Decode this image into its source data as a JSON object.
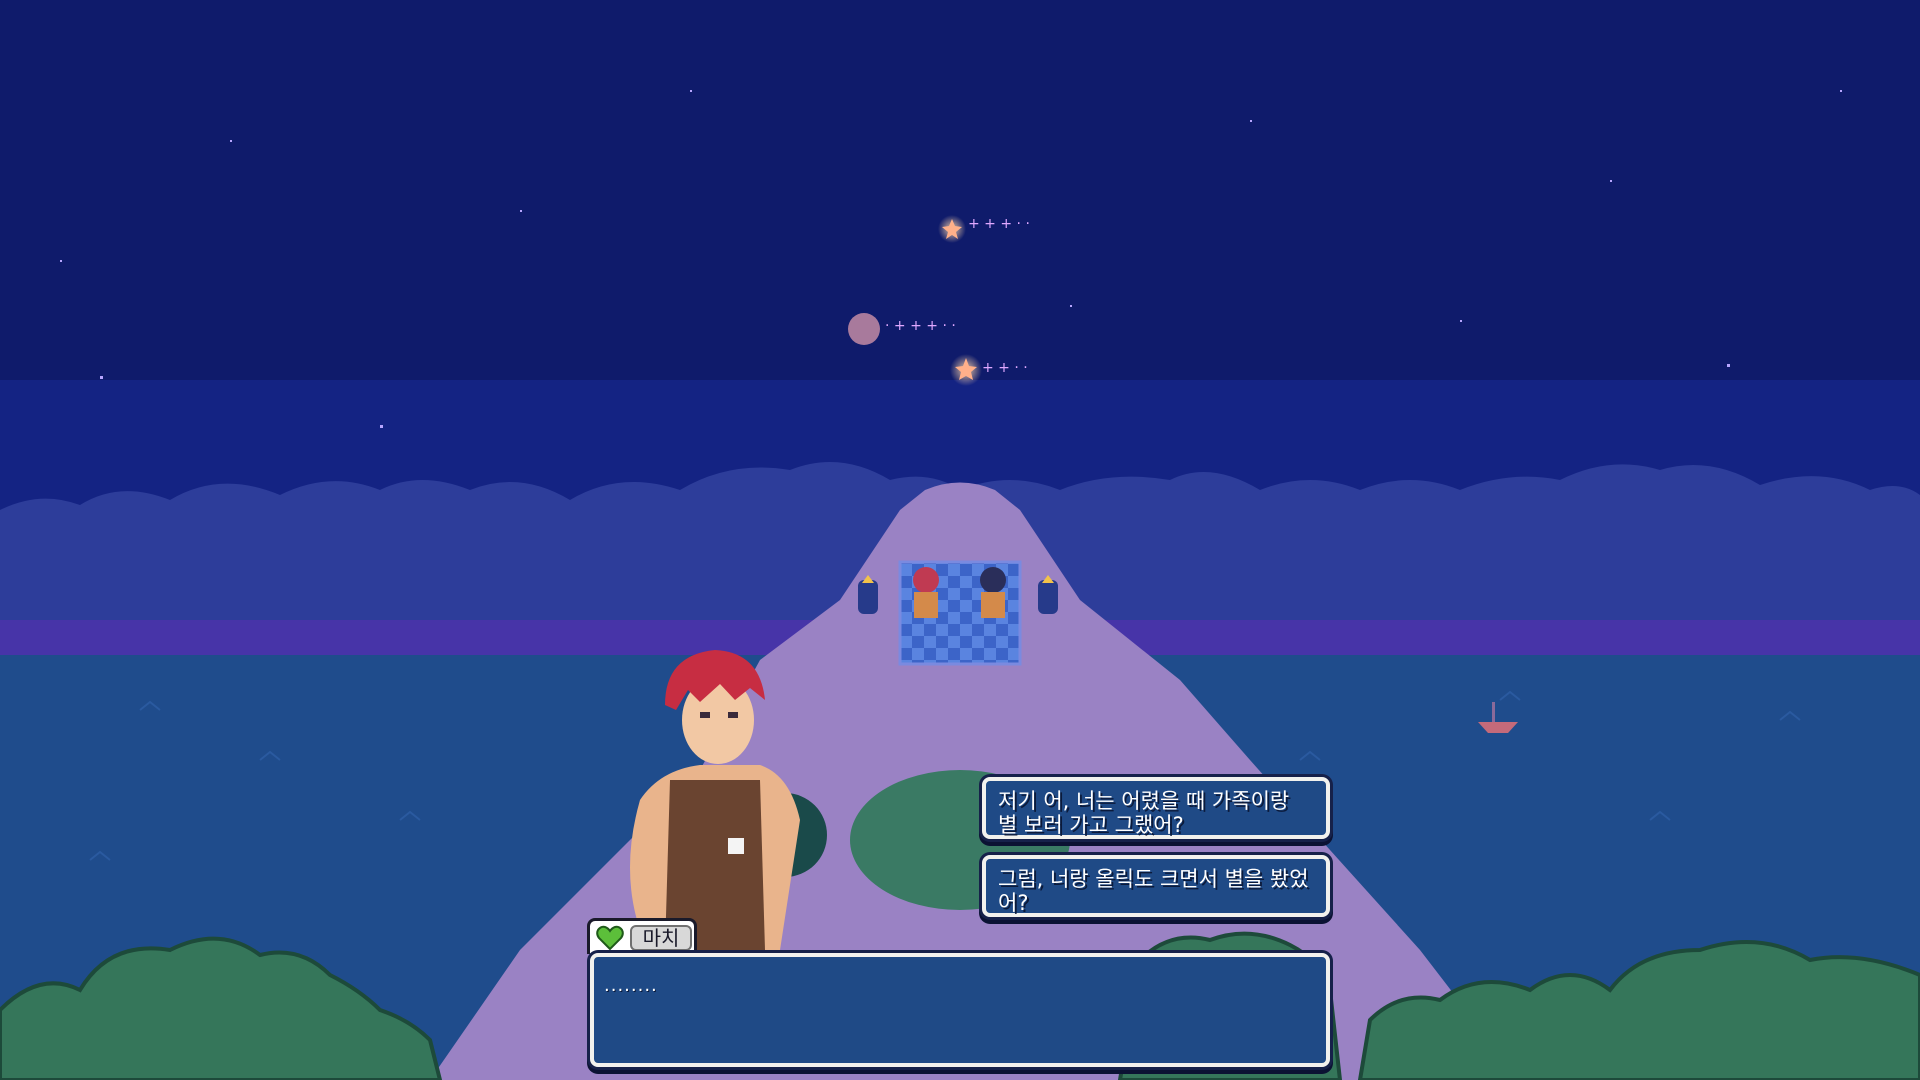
{
  "dialogue": {
    "speaker_name": "마치",
    "text": "........",
    "affection_icon": "heart-icon",
    "affection_color": "#5cbf3a"
  },
  "choices": [
    {
      "label": "저기 어, 너는 어렸을 때 가족이랑 별 보러 가고 그랬어?"
    },
    {
      "label": "그럼, 너랑 올릭도 크면서 별을 봤었어?"
    }
  ],
  "colors": {
    "sky": "#0f1b6b",
    "clouds": "#2d3d9a",
    "hill": "#9a82c4",
    "water": "#1f4c8c",
    "bushes": "#35765a",
    "panel": "#1f4a86",
    "panel_border": "#f2f2ee"
  }
}
